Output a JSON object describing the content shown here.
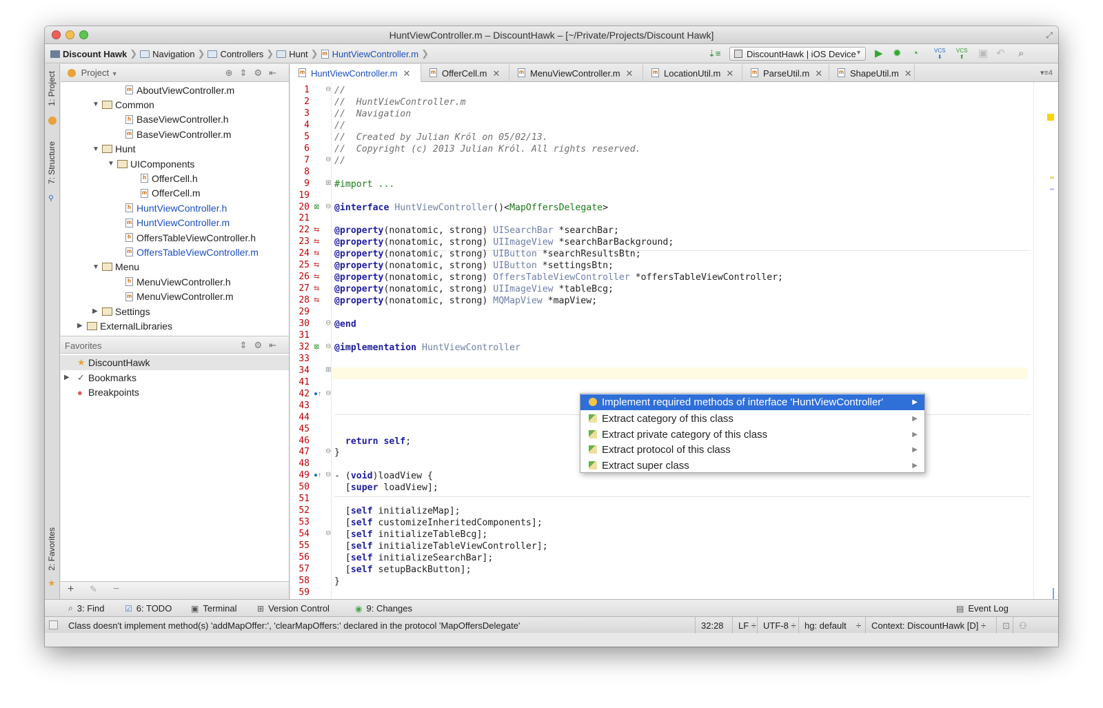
{
  "window": {
    "title": "HuntViewController.m – DiscountHawk – [~/Private/Projects/Discount Hawk]"
  },
  "navbar": {
    "breadcrumbs": [
      "Discount Hawk",
      "Navigation",
      "Controllers",
      "Hunt",
      "HuntViewController.m"
    ],
    "run_config": "DiscountHawk | iOS Device",
    "vcs1": "VCS",
    "vcs2": "VCS"
  },
  "sidebar": {
    "tab_project": "1: Project",
    "tab_structure": "7: Structure",
    "tab_favorites": "2: Favorites"
  },
  "project_panel": {
    "header": "Project",
    "tree": [
      {
        "label": "AboutViewController.m",
        "kind": "file-m",
        "level": 3,
        "expander": ""
      },
      {
        "label": "Common",
        "kind": "folder",
        "level": 2,
        "expander": "▼"
      },
      {
        "label": "BaseViewController.h",
        "kind": "file-h",
        "level": 3,
        "expander": ""
      },
      {
        "label": "BaseViewController.m",
        "kind": "file-m",
        "level": 3,
        "expander": ""
      },
      {
        "label": "Hunt",
        "kind": "folder",
        "level": 2,
        "expander": "▼"
      },
      {
        "label": "UIComponents",
        "kind": "folder",
        "level": 3,
        "expander": "▼"
      },
      {
        "label": "OfferCell.h",
        "kind": "file-h",
        "level": 4,
        "expander": ""
      },
      {
        "label": "OfferCell.m",
        "kind": "file-m",
        "level": 4,
        "expander": ""
      },
      {
        "label": "HuntViewController.h",
        "kind": "file-h",
        "level": 3,
        "expander": "",
        "highlight": true
      },
      {
        "label": "HuntViewController.m",
        "kind": "file-m",
        "level": 3,
        "expander": "",
        "highlight": true
      },
      {
        "label": "OffersTableViewController.h",
        "kind": "file-h",
        "level": 3,
        "expander": ""
      },
      {
        "label": "OffersTableViewController.m",
        "kind": "file-m",
        "level": 3,
        "expander": "",
        "highlight": true
      },
      {
        "label": "Menu",
        "kind": "folder",
        "level": 2,
        "expander": "▼"
      },
      {
        "label": "MenuViewController.h",
        "kind": "file-h",
        "level": 3,
        "expander": ""
      },
      {
        "label": "MenuViewController.m",
        "kind": "file-m",
        "level": 3,
        "expander": ""
      },
      {
        "label": "Settings",
        "kind": "folder",
        "level": 2,
        "expander": "▶"
      },
      {
        "label": "ExternalLibraries",
        "kind": "folder",
        "level": 1,
        "expander": "▶"
      }
    ]
  },
  "favorites_panel": {
    "header": "Favorites",
    "items": [
      {
        "label": "DiscountHawk",
        "icon": "★",
        "selected": true,
        "expander": ""
      },
      {
        "label": "Bookmarks",
        "icon": "✓",
        "selected": false,
        "expander": "▶"
      },
      {
        "label": "Breakpoints",
        "icon": "●",
        "selected": false,
        "expander": ""
      }
    ],
    "bottom_add": "+",
    "bottom_edit": "✎",
    "bottom_remove": "−"
  },
  "editor": {
    "tabs": [
      {
        "label": "HuntViewController.m",
        "kind": "m",
        "active": true
      },
      {
        "label": "OfferCell.m",
        "kind": "m",
        "active": false
      },
      {
        "label": "MenuViewController.m",
        "kind": "m",
        "active": false
      },
      {
        "label": "LocationUtil.m",
        "kind": "m",
        "active": false
      },
      {
        "label": "ParseUtil.m",
        "kind": "m",
        "active": false
      },
      {
        "label": "ShapeUtil.m",
        "kind": "m",
        "active": false
      }
    ],
    "tabs_more": "▾≡4",
    "lines": [
      {
        "n": "1",
        "segs": [
          [
            "cm",
            "//"
          ]
        ]
      },
      {
        "n": "2",
        "segs": [
          [
            "cm",
            "//  HuntViewController.m"
          ]
        ]
      },
      {
        "n": "3",
        "segs": [
          [
            "cm",
            "//  Navigation"
          ]
        ]
      },
      {
        "n": "4",
        "segs": [
          [
            "cm",
            "//"
          ]
        ]
      },
      {
        "n": "5",
        "segs": [
          [
            "cm",
            "//  Created by Julian Król on 05/02/13."
          ]
        ]
      },
      {
        "n": "6",
        "segs": [
          [
            "cm",
            "//  Copyright (c) 2013 Julian Król. All rights reserved."
          ]
        ]
      },
      {
        "n": "7",
        "segs": [
          [
            "cm",
            "//"
          ]
        ]
      },
      {
        "n": "8",
        "segs": []
      },
      {
        "n": "9",
        "segs": [
          [
            "gr",
            "#import ..."
          ]
        ]
      },
      {
        "n": "19",
        "segs": []
      },
      {
        "n": "20",
        "segs": [
          [
            "kw",
            "@interface"
          ],
          [
            "",
            " "
          ],
          [
            "ty",
            "HuntViewController"
          ],
          [
            "",
            "()<"
          ],
          [
            "gr",
            "MapOffersDelegate"
          ],
          [
            "",
            ">"
          ]
        ]
      },
      {
        "n": "21",
        "segs": []
      },
      {
        "n": "22",
        "segs": [
          [
            "kw",
            "@property"
          ],
          [
            "",
            "(nonatomic, strong) "
          ],
          [
            "ty",
            "UISearchBar"
          ],
          [
            "",
            " *searchBar;"
          ]
        ]
      },
      {
        "n": "23",
        "segs": [
          [
            "kw",
            "@property"
          ],
          [
            "",
            "(nonatomic, strong) "
          ],
          [
            "ty",
            "UIImageView"
          ],
          [
            "",
            " *searchBarBackground;"
          ]
        ]
      },
      {
        "n": "24",
        "segs": [
          [
            "kw",
            "@property"
          ],
          [
            "",
            "(nonatomic, strong) "
          ],
          [
            "ty",
            "UIButton"
          ],
          [
            "",
            " *searchResultsBtn;"
          ]
        ]
      },
      {
        "n": "25",
        "segs": [
          [
            "kw",
            "@property"
          ],
          [
            "",
            "(nonatomic, strong) "
          ],
          [
            "ty",
            "UIButton"
          ],
          [
            "",
            " *settingsBtn;"
          ]
        ]
      },
      {
        "n": "26",
        "segs": [
          [
            "kw",
            "@property"
          ],
          [
            "",
            "(nonatomic, strong) "
          ],
          [
            "ty",
            "OffersTableViewController"
          ],
          [
            "",
            " *offersTableViewController;"
          ]
        ]
      },
      {
        "n": "27",
        "segs": [
          [
            "kw",
            "@property"
          ],
          [
            "",
            "(nonatomic, strong) "
          ],
          [
            "ty",
            "UIImageView"
          ],
          [
            "",
            " *tableBcg;"
          ]
        ]
      },
      {
        "n": "28",
        "segs": [
          [
            "kw",
            "@property"
          ],
          [
            "",
            "(nonatomic, strong) "
          ],
          [
            "ty",
            "MQMapView"
          ],
          [
            "",
            " *mapView;"
          ]
        ]
      },
      {
        "n": "29",
        "segs": []
      },
      {
        "n": "30",
        "segs": [
          [
            "kw",
            "@end"
          ]
        ]
      },
      {
        "n": "31",
        "segs": []
      },
      {
        "n": "32",
        "segs": [
          [
            "kw",
            "@implementation"
          ],
          [
            "",
            " "
          ],
          [
            "ty",
            "HuntViewController"
          ]
        ]
      },
      {
        "n": "33",
        "segs": []
      },
      {
        "n": "34",
        "segs": []
      },
      {
        "n": "41",
        "segs": []
      },
      {
        "n": "42",
        "segs": []
      },
      {
        "n": "43",
        "segs": []
      },
      {
        "n": "44",
        "segs": []
      },
      {
        "n": "45",
        "segs": []
      },
      {
        "n": "46",
        "segs": [
          [
            "",
            "  "
          ],
          [
            "kw",
            "return self"
          ],
          [
            "",
            ";"
          ]
        ]
      },
      {
        "n": "47",
        "segs": [
          [
            "",
            "}"
          ]
        ]
      },
      {
        "n": "48",
        "segs": []
      },
      {
        "n": "49",
        "segs": [
          [
            "",
            "- ("
          ],
          [
            "kw",
            "void"
          ],
          [
            "",
            ")loadView {"
          ]
        ]
      },
      {
        "n": "50",
        "segs": [
          [
            "",
            "  ["
          ],
          [
            "kw",
            "super"
          ],
          [
            "",
            " loadView];"
          ]
        ]
      },
      {
        "n": "51",
        "segs": []
      },
      {
        "n": "52",
        "segs": [
          [
            "",
            "  ["
          ],
          [
            "kw",
            "self"
          ],
          [
            "",
            " initializeMap];"
          ]
        ]
      },
      {
        "n": "53",
        "segs": [
          [
            "",
            "  ["
          ],
          [
            "kw",
            "self"
          ],
          [
            "",
            " customizeInheritedComponents];"
          ]
        ]
      },
      {
        "n": "54",
        "segs": [
          [
            "",
            "  ["
          ],
          [
            "kw",
            "self"
          ],
          [
            "",
            " initializeTableBcg];"
          ]
        ]
      },
      {
        "n": "55",
        "segs": [
          [
            "",
            "  ["
          ],
          [
            "kw",
            "self"
          ],
          [
            "",
            " initializeTableViewController];"
          ]
        ]
      },
      {
        "n": "56",
        "segs": [
          [
            "",
            "  ["
          ],
          [
            "kw",
            "self"
          ],
          [
            "",
            " initializeSearchBar];"
          ]
        ]
      },
      {
        "n": "57",
        "segs": [
          [
            "",
            "  ["
          ],
          [
            "kw",
            "self"
          ],
          [
            "",
            " setupBackButton];"
          ]
        ]
      },
      {
        "n": "58",
        "segs": [
          [
            "",
            "}"
          ]
        ]
      },
      {
        "n": "59",
        "segs": []
      }
    ]
  },
  "intention_popup": {
    "items": [
      {
        "label": "Implement required methods of interface 'HuntViewController'",
        "icon": "bulb",
        "selected": true
      },
      {
        "label": "Extract category of this class",
        "icon": "pencil",
        "selected": false
      },
      {
        "label": "Extract private category of this class",
        "icon": "pencil",
        "selected": false
      },
      {
        "label": "Extract protocol of this class",
        "icon": "pencil",
        "selected": false
      },
      {
        "label": "Extract super class",
        "icon": "pencil",
        "selected": false
      }
    ]
  },
  "toolwindows": {
    "find": "3: Find",
    "todo": "6: TODO",
    "terminal": "Terminal",
    "vcs": "Version Control",
    "changes": "9: Changes",
    "eventlog": "Event Log"
  },
  "statusbar": {
    "message": "Class doesn't implement method(s) 'addMapOffer:', 'clearMapOffers:' declared in the protocol 'MapOffersDelegate'",
    "position": "32:28",
    "line_sep": "LF ÷",
    "encoding": "UTF-8 ÷",
    "vcs_branch": "hg: default",
    "vcs_arrows": "÷",
    "context": "Context: DiscountHawk [D] ÷"
  },
  "colors": {
    "accent": "#2f6fd8",
    "line_number": "#c00000",
    "keyword": "#1e1e9e",
    "comment": "#707070"
  }
}
